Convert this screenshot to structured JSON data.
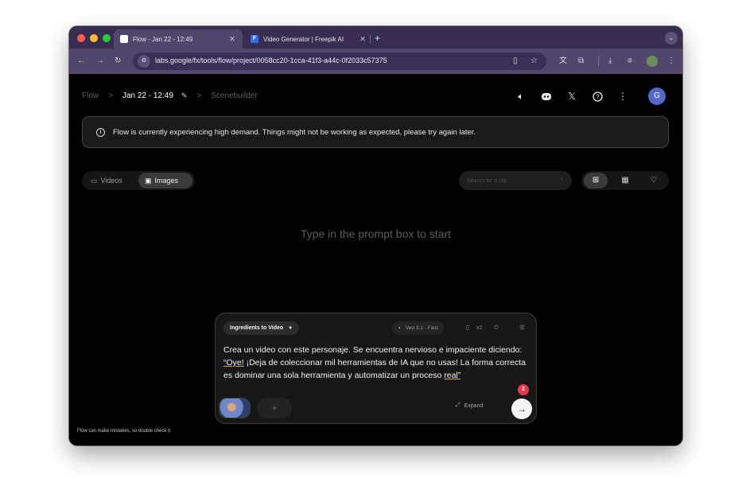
{
  "browser": {
    "tabs": [
      {
        "title": "Flow - Jan 22 - 12:49",
        "close": "✕",
        "favicon": "flow-favicon"
      },
      {
        "title": "Video Generator | Freepik AI",
        "close": "✕",
        "favicon": "freepik-favicon",
        "favicon_letter": "F"
      }
    ],
    "new_tab": "+",
    "profile_menu": "⌄",
    "nav": {
      "back": "←",
      "forward": "→",
      "reload": "↻"
    },
    "site_info_icon": "site-settings-icon",
    "url": "labs.google/fx/tools/flow/project/0058cc20-1cca-41f3-a44c-0f2033c57375"
  },
  "header": {
    "crumbs": [
      "Flow",
      "Jan 22 - 12:49",
      "Scenebuilder"
    ],
    "separator": ">",
    "avatar_letter": "G"
  },
  "banner": {
    "text": "Flow is currently experiencing high demand. Things might not be working as expected, please try again later."
  },
  "media_tabs": [
    {
      "label": "Videos",
      "icon": "video-icon",
      "active": false
    },
    {
      "label": "Images",
      "icon": "image-icon",
      "active": true
    }
  ],
  "search": {
    "placeholder": "Search for a clip"
  },
  "empty_state": {
    "text": "Type in the prompt box to start"
  },
  "composer": {
    "mode": "Ingredients to Video",
    "model": "Veo 3.1 - Fast",
    "count": "x1",
    "prompt_before": "Crea un video con este personaje. Se encuentra nervioso e impaciente diciendo: ",
    "prompt_open_quote": "“",
    "prompt_highlight": "Oye!",
    "prompt_after": " ¡Deja de coleccionar mil herramientas de IA que no usas! La forma correcta es dominar una sola herramienta y automatizar un proceso ",
    "prompt_tail": "real”",
    "add_label": "+",
    "expand_label": "Expand",
    "badge_count": "2",
    "send": "→"
  },
  "footer": {
    "disclaimer": "Flow can make mistakes, so double check it"
  },
  "colors": {
    "accent_avatar": "#5468c7",
    "badge": "#e53950",
    "browser_chrome": "#51466c",
    "tab_strip": "#3a2d52"
  }
}
